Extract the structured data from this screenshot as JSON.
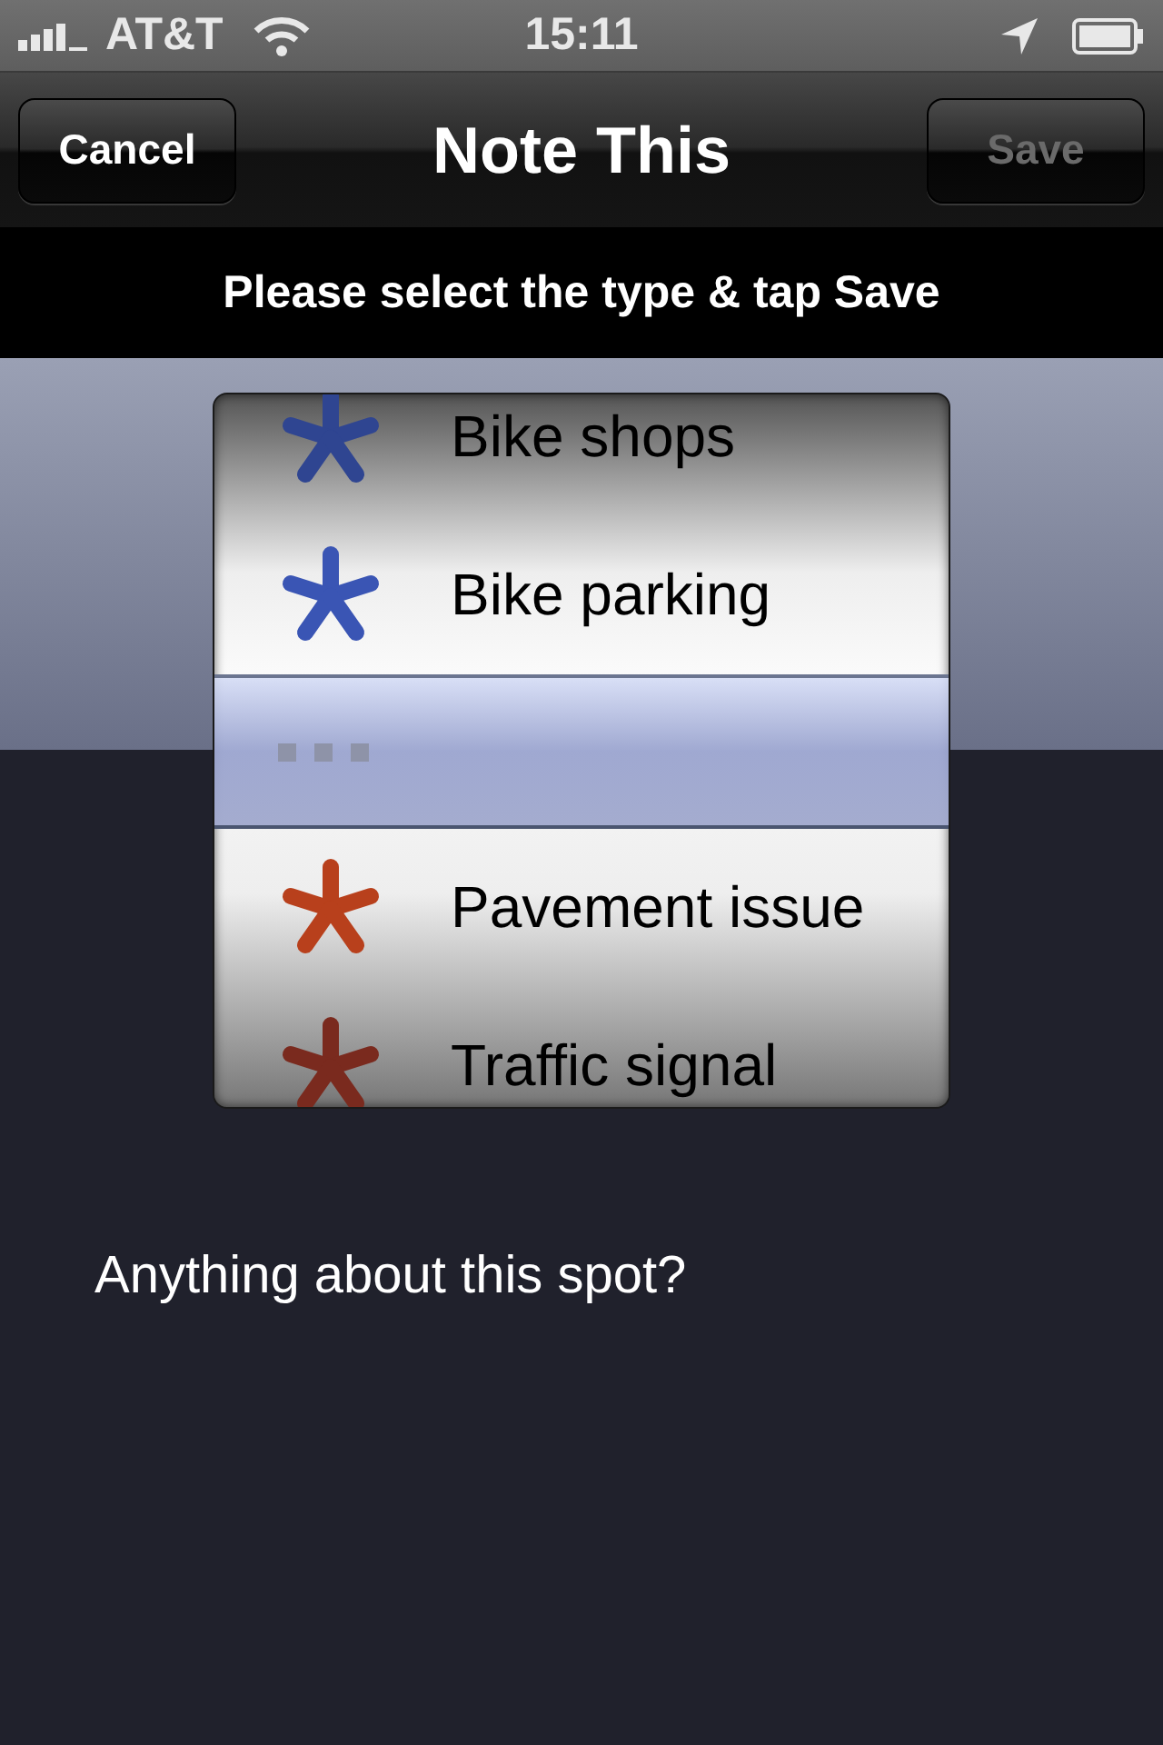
{
  "status_bar": {
    "carrier": "AT&T",
    "time": "15:11"
  },
  "nav": {
    "title": "Note This",
    "left_button": {
      "label": "Cancel",
      "disabled": false
    },
    "right_button": {
      "label": "Save",
      "disabled": true
    }
  },
  "banner": "Please select the type & tap Save",
  "picker": {
    "items": [
      {
        "kind": "marker",
        "label": "Bike shops",
        "color": "#2f4591",
        "selected": false
      },
      {
        "kind": "marker",
        "label": "Bike parking",
        "color": "#3a55b4",
        "selected": false
      },
      {
        "kind": "dots",
        "selected": true
      },
      {
        "kind": "marker",
        "label": "Pavement issue",
        "color": "#b8401c",
        "selected": false
      },
      {
        "kind": "marker",
        "label": "Traffic signal",
        "color": "#7a2a1e",
        "selected": false
      }
    ]
  },
  "prompt": "Anything about this spot?"
}
